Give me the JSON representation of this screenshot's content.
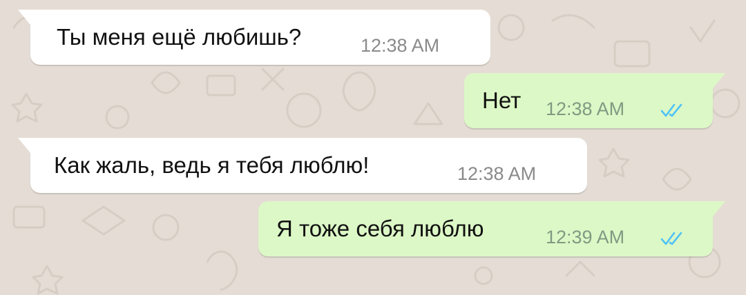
{
  "chat": {
    "messages": [
      {
        "direction": "incoming",
        "text": "Ты меня ещё любишь?",
        "time": "12:38 AM"
      },
      {
        "direction": "outgoing",
        "text": "Нет",
        "time": "12:38 AM",
        "status_icon": "double-check-read-icon"
      },
      {
        "direction": "incoming",
        "text": "Как жаль, ведь я тебя люблю!",
        "time": "12:38 AM"
      },
      {
        "direction": "outgoing",
        "text": "Я тоже себя люблю",
        "time": "12:39 AM",
        "status_icon": "double-check-read-icon"
      }
    ]
  },
  "colors": {
    "background": "#e5ddd5",
    "incoming_bubble": "#ffffff",
    "outgoing_bubble": "#dcf8c6",
    "read_ticks": "#4fc3f7"
  }
}
